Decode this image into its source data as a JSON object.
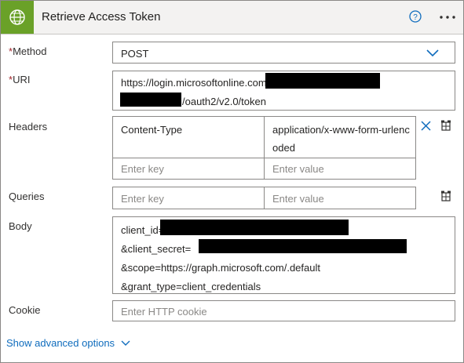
{
  "header": {
    "title": "Retrieve Access Token",
    "icon": "globe-icon",
    "help_icon": "help-circle-icon",
    "more_icon": "more-ellipsis-icon",
    "brand_color": "#6aa128"
  },
  "method": {
    "label": "Method",
    "required_mark": "*",
    "value": "POST"
  },
  "uri": {
    "label": "URI",
    "required_mark": "*",
    "line1": "https://login.microsoftonline.com/",
    "line2_suffix": "/oauth2/v2.0/token"
  },
  "headers": {
    "label": "Headers",
    "rows": [
      {
        "key": "Content-Type",
        "value_line1": "application/x-www-form-urlenc",
        "value_line2": "oded"
      }
    ],
    "key_placeholder": "Enter key",
    "value_placeholder": "Enter value"
  },
  "queries": {
    "label": "Queries",
    "key_placeholder": "Enter key",
    "value_placeholder": "Enter value"
  },
  "body": {
    "label": "Body",
    "lines": [
      "client_id=",
      "&client_secret=",
      "&scope=https://graph.microsoft.com/.default",
      "&grant_type=client_credentials"
    ]
  },
  "cookie": {
    "label": "Cookie",
    "placeholder": "Enter HTTP cookie"
  },
  "advanced": {
    "label": "Show advanced options"
  },
  "accent_color": "#0f6cbd"
}
